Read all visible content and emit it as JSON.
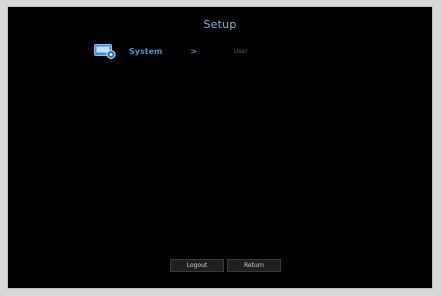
{
  "header": {
    "title": "Setup"
  },
  "breadcrumb": {
    "icon": "system-monitor-icon",
    "section_label": "System",
    "separator": ">",
    "subsection_label": "User"
  },
  "footer": {
    "logout_label": "Logout",
    "return_label": "Return"
  },
  "colors": {
    "background": "#000000",
    "accent": "#4b93d1",
    "title": "#7fb6e2",
    "muted_text": "#5a5a5a"
  }
}
